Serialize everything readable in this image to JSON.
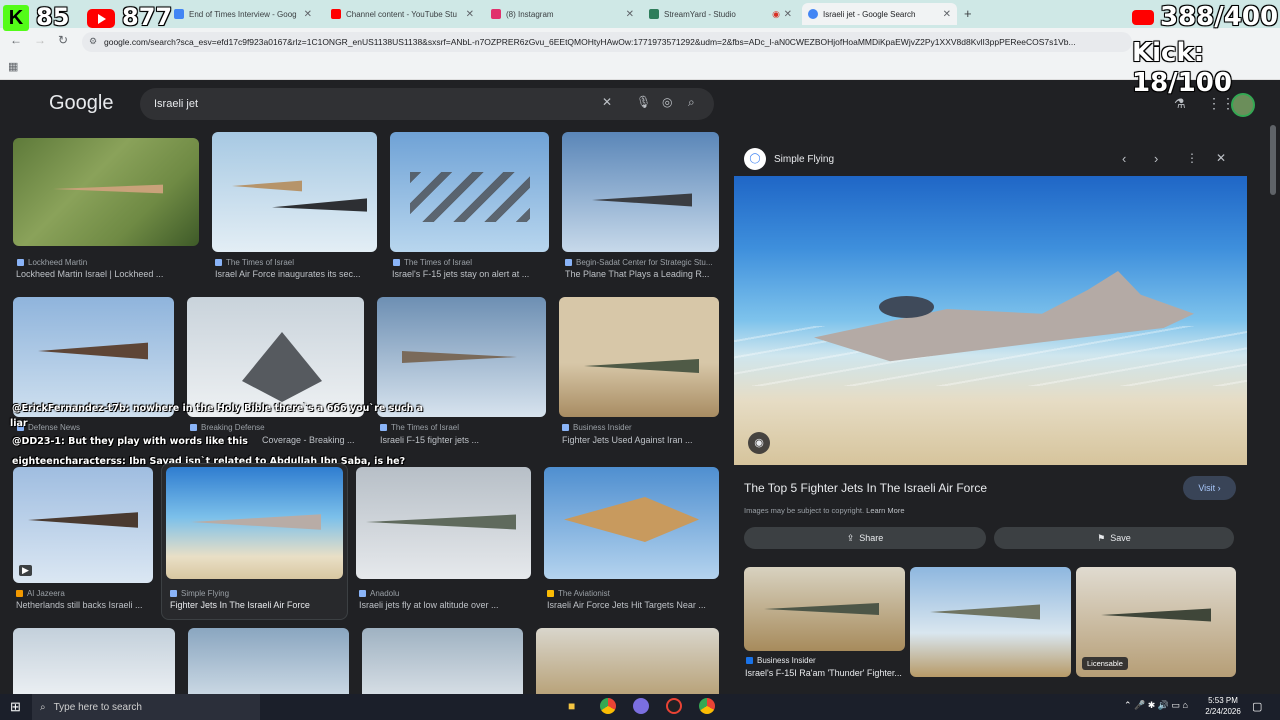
{
  "browser": {
    "tabs": [
      {
        "label": "End of Times Interview - Goog",
        "color": "#4285f4"
      },
      {
        "label": "Channel content - YouTube Stu",
        "color": "#ff0000"
      },
      {
        "label": "(8) Instagram",
        "color": "#e1306c"
      },
      {
        "label": "StreamYard - Studio",
        "color": "#2e7d5b"
      },
      {
        "label": "Israeli jet - Google Search",
        "color": "#4285f4"
      }
    ],
    "url": "google.com/search?sca_esv=efd17c9f923a0167&rlz=1C1ONGR_enUS1138US1138&sxsrf=ANbL-n7OZPRER6zGvu_6EEtQMOHtyHAwOw:1771973571292&udm=2&fbs=ADc_l-aN0CWEZBOHjofHoaMMDiKpaEWjvZ2Py1XXV8d8KvlI3ppPEReeCOS7s1Vb..."
  },
  "stream_overlay": {
    "kick_count": "85",
    "yt_count": "877",
    "yt_goal": "388/400",
    "kick_goal": "Kick: 18/100"
  },
  "google": {
    "logo": "Google",
    "query": "Israeli jet"
  },
  "results": [
    {
      "source": "Lockheed Martin",
      "caption": "Lockheed Martin Israel | Lockheed ..."
    },
    {
      "source": "The Times of Israel",
      "caption": "Israel Air Force inaugurates its sec..."
    },
    {
      "source": "The Times of Israel",
      "caption": "Israel's F-15 jets stay on alert at ..."
    },
    {
      "source": "Begin-Sadat Center for Strategic Stu...",
      "caption": "The Plane That Plays a Leading R..."
    },
    {
      "source": "Defense News",
      "caption": ""
    },
    {
      "source": "Breaking Defense",
      "caption": "Coverage - Breaking ..."
    },
    {
      "source": "The Times of Israel",
      "caption": "Israeli F-15 fighter jets ..."
    },
    {
      "source": "Business Insider",
      "caption": "Fighter Jets Used Against Iran ..."
    },
    {
      "source": "Al Jazeera",
      "caption": "Netherlands still backs Israeli ..."
    },
    {
      "source": "Simple Flying",
      "caption": "Fighter Jets In The Israeli Air Force"
    },
    {
      "source": "Anadolu",
      "caption": "Israeli jets fly at low altitude over ..."
    },
    {
      "source": "The Aviationist",
      "caption": "Israeli Air Force Jets Hit Targets Near ..."
    }
  ],
  "chat": [
    {
      "user": "@ErickFernandez-t7b",
      "msg": ": nowhere in the Holy Bible there`s a 666 you`re such a",
      "cont": "liar"
    },
    {
      "user": "@DD23-1",
      "msg": ": But they play with words like this",
      "cont": ""
    },
    {
      "user": "eighteencharacterss",
      "msg": ": Ibn Sayad isn`t related to Abdullah Ibn Saba, is he?",
      "cont": ""
    }
  ],
  "panel": {
    "site": "Simple Flying",
    "title": "The Top 5 Fighter Jets In The Israeli Air Force",
    "visit": "Visit",
    "copyright": "Images may be subject to copyright.",
    "learn_more": "Learn More",
    "share": "Share",
    "save": "Save",
    "related_source": "Business Insider",
    "related_caption": "Israel's F-15I Ra'am 'Thunder' Fighter...",
    "licensable": "Licensable"
  },
  "taskbar": {
    "search_placeholder": "Type here to search",
    "time": "5:53 PM",
    "date": "2/24/2026"
  }
}
